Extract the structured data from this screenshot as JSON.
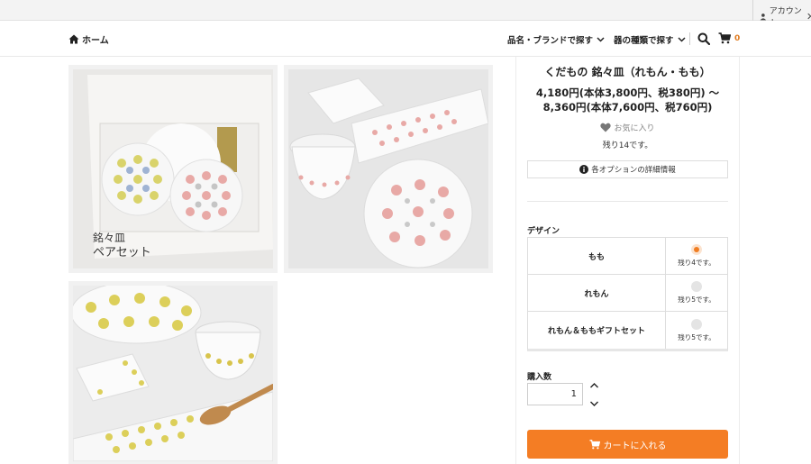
{
  "topbar": {
    "account_label": "アカウント"
  },
  "header": {
    "home_label": "ホーム",
    "nav_brand": "品名・ブランドで探す",
    "nav_type": "器の種類で探す",
    "cart_count": "0"
  },
  "gallery": {
    "photo1_caption_line1": "銘々皿",
    "photo1_caption_line2": "ペアセット"
  },
  "product": {
    "title": "くだもの 銘々皿（れもん・もも）",
    "price": "4,180円(本体3,800円、税380円) 〜 8,360円(本体7,600円、税760円)",
    "favorite_label": "お気に入り",
    "stock": "残り14です。",
    "option_info": "各オプションの詳細情報",
    "design_label": "デザイン",
    "options": [
      {
        "name": "もも",
        "stock": "残り4です。",
        "selected": true
      },
      {
        "name": "れもん",
        "stock": "残り5です。",
        "selected": false
      },
      {
        "name": "れもん＆ももギフトセット",
        "stock": "残り5です。",
        "selected": false
      }
    ],
    "quantity_label": "購入数",
    "quantity_value": "1",
    "add_to_cart": "カートに入れる"
  },
  "colors": {
    "accent": "#f47d24",
    "radio_selected": "#f07d22"
  }
}
